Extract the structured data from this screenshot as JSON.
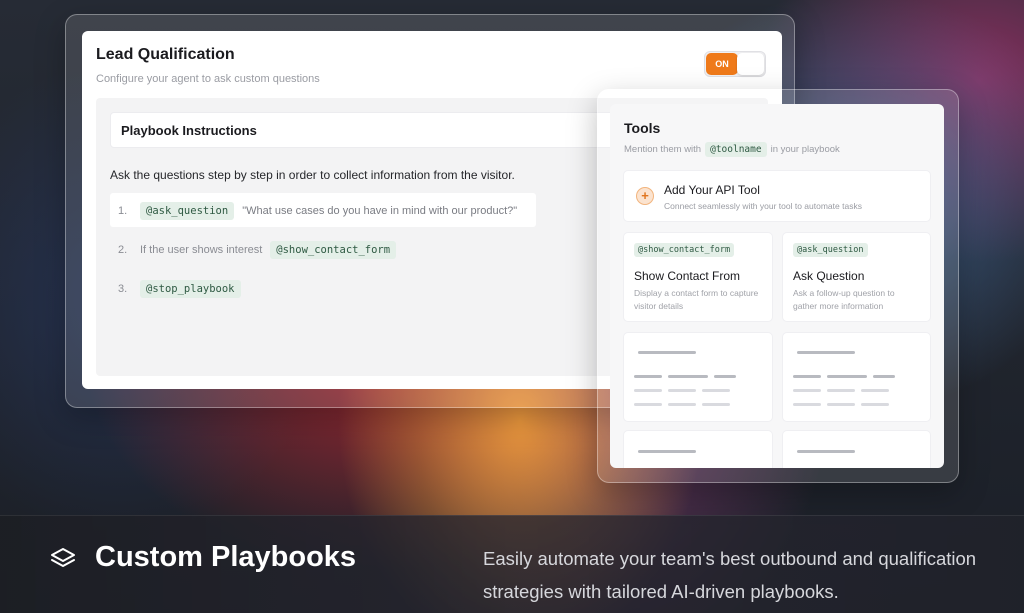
{
  "lead": {
    "title": "Lead Qualification",
    "subtitle": "Configure your agent to ask custom questions",
    "toggle_label": "ON",
    "toggle_state": "on",
    "accent_color": "#ef7a1a"
  },
  "playbook": {
    "header": "Playbook Instructions",
    "description": "Ask the questions step by step in order to collect information from the visitor.",
    "steps": [
      {
        "num": "1.",
        "tag": "@ask_question",
        "text": "\"What use cases do you have in mind with our product?\""
      },
      {
        "num": "2.",
        "text": "If the user shows interest",
        "tag": "@show_contact_form"
      },
      {
        "num": "3.",
        "tag": "@stop_playbook"
      }
    ]
  },
  "tools": {
    "title": "Tools",
    "subtitle_prefix": "Mention them with",
    "subtitle_tag": "@toolname",
    "subtitle_suffix": "in your playbook",
    "api_card": {
      "icon": "plus-circle-icon",
      "title": "Add Your API Tool",
      "desc": "Connect seamlessly with your tool to automate tasks"
    },
    "cards": [
      {
        "tag": "@show_contact_form",
        "title": "Show Contact From",
        "desc": "Display a contact form to capture visitor details"
      },
      {
        "tag": "@ask_question",
        "title": "Ask Question",
        "desc": "Ask a follow-up question to gather more information"
      }
    ]
  },
  "feature": {
    "icon": "layers-icon",
    "title": "Custom Playbooks",
    "description": "Easily automate your team's best outbound and qualification strategies with tailored AI-driven playbooks."
  }
}
